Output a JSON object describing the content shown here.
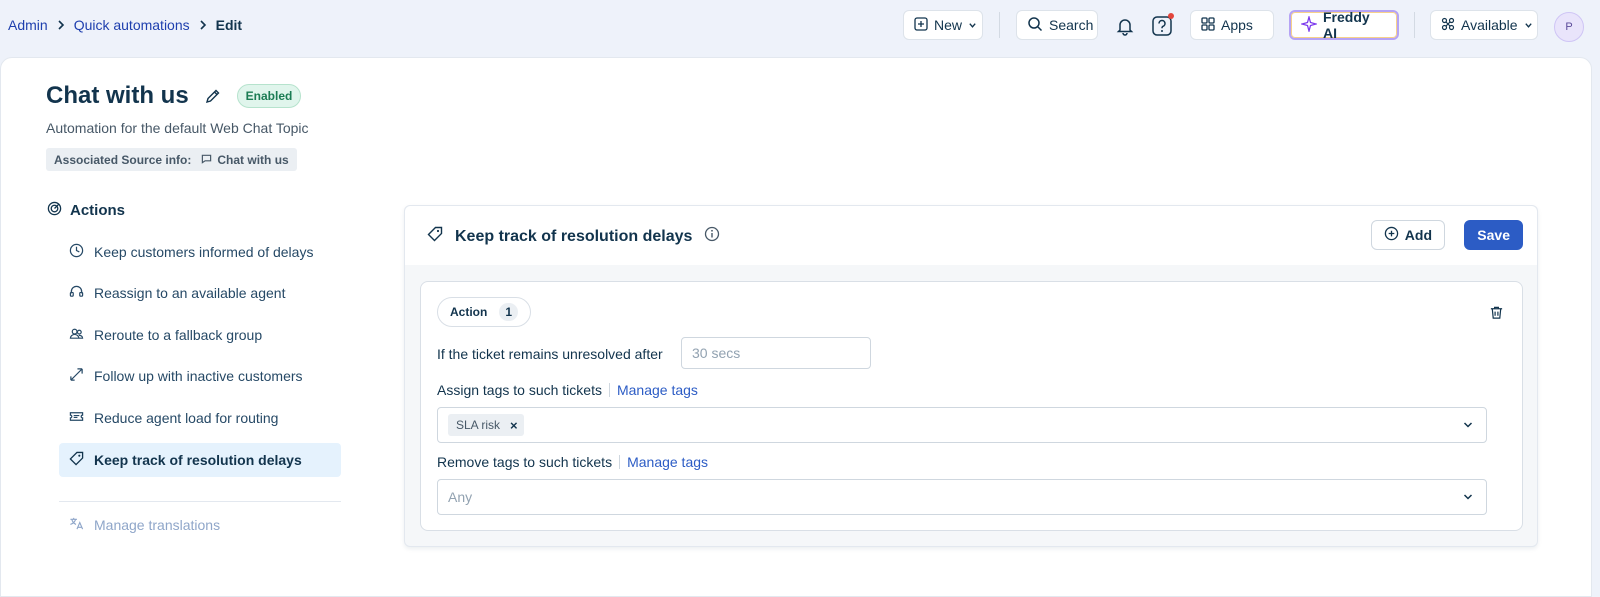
{
  "breadcrumb": {
    "items": [
      "Admin",
      "Quick automations"
    ],
    "current": "Edit"
  },
  "topbar": {
    "new_label": "New",
    "search_label": "Search",
    "apps_label": "Apps",
    "freddy_label": "Freddy AI",
    "status_label": "Available",
    "avatar_initial": "P"
  },
  "header": {
    "title": "Chat with us",
    "status_badge": "Enabled",
    "subtitle": "Automation for the default Web Chat Topic",
    "source_label": "Associated Source info:",
    "source_value": "Chat with us"
  },
  "sidebar": {
    "heading": "Actions",
    "items": [
      {
        "label": "Keep customers informed of delays",
        "icon": "clock-icon"
      },
      {
        "label": "Reassign to an available agent",
        "icon": "headset-icon"
      },
      {
        "label": "Reroute to a fallback group",
        "icon": "group-icon"
      },
      {
        "label": "Follow up with inactive customers",
        "icon": "arrows-icon"
      },
      {
        "label": "Reduce agent load for routing",
        "icon": "ticket-icon"
      },
      {
        "label": "Keep track of resolution delays",
        "icon": "tag-icon",
        "active": true
      }
    ],
    "footer_item": "Manage translations"
  },
  "card": {
    "title": "Keep track of resolution delays",
    "add_label": "Add",
    "save_label": "Save",
    "action": {
      "chip_label": "Action",
      "chip_number": "1",
      "unresolved_label": "If the ticket remains unresolved after",
      "unresolved_placeholder": "30 secs",
      "assign_label": "Assign tags to such tickets",
      "assign_manage": "Manage tags",
      "assigned_tag": "SLA risk",
      "remove_label": "Remove tags to such tickets",
      "remove_manage": "Manage tags",
      "remove_placeholder": "Any"
    }
  },
  "colors": {
    "primary": "#2c5cc5",
    "active_bg": "#e5f2fd",
    "badge_green": "#1c7c54"
  }
}
